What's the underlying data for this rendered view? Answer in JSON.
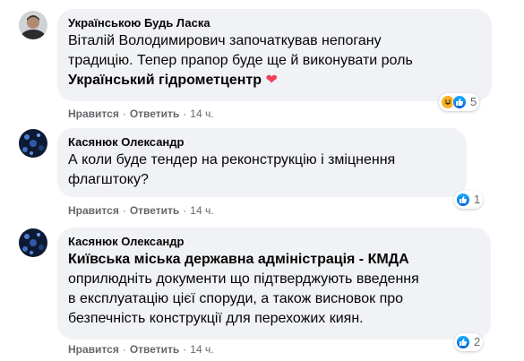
{
  "comments": [
    {
      "author": "Українською Будь Ласка",
      "text_lines": [
        "Віталій Володимирович започаткував непогану",
        "традицію. Тепер прапор буде ще й виконувати роль"
      ],
      "mention": "Український гідрометцентр",
      "heart": "❤",
      "actions": {
        "like": "Нравится",
        "reply": "Ответить",
        "time": "14 ч."
      },
      "reaction_icons": [
        "haha-icon",
        "like-icon"
      ],
      "reaction_count": "5"
    },
    {
      "author": "Касянюк Олександр",
      "text_lines": [
        "А коли буде тендер на реконструкцію і зміцнення",
        "флагштоку?"
      ],
      "actions": {
        "like": "Нравится",
        "reply": "Ответить",
        "time": "14 ч."
      },
      "reaction_icons": [
        "like-icon"
      ],
      "reaction_count": "1"
    },
    {
      "author": "Касянюк Олександр",
      "mention": "Київська міська державна адміністрація - КМДА",
      "text_lines": [
        "оприлюдніть документи що підтверджують введення",
        "в експлуатацію цієї споруди, а також висновок про",
        "безпечність конструкції для перехожих киян."
      ],
      "actions": {
        "like": "Нравится",
        "reply": "Ответить",
        "time": "14 ч."
      },
      "reaction_icons": [
        "like-icon"
      ],
      "reaction_count": "2"
    }
  ],
  "separator": "·",
  "colors": {
    "bubble": "#f0f2f5",
    "meta": "#65676b",
    "like_blue": "#1877f2",
    "heart": "#f33e58"
  }
}
